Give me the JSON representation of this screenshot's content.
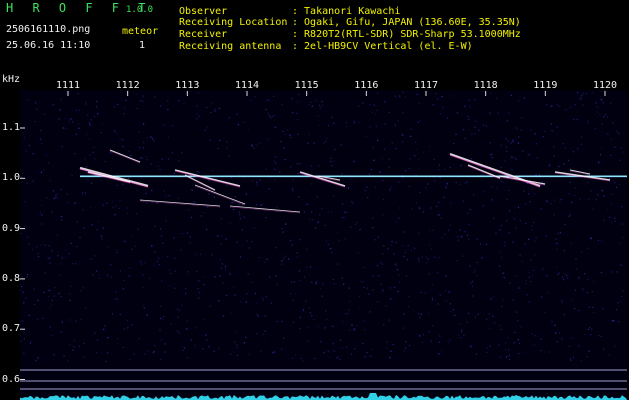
{
  "app": {
    "title": "H R O F F T",
    "version": "1.0.0"
  },
  "file": {
    "name": "2506161110.png",
    "datetime": "25.06.16 11:10"
  },
  "meteor": {
    "label": "meteor",
    "count": "1"
  },
  "info": [
    {
      "label": "Observer",
      "value": ": Takanori Kawachi"
    },
    {
      "label": "Receiving Location",
      "value": ": Ogaki, Gifu, JAPAN (136.60E, 35.35N)"
    },
    {
      "label": "Receiver",
      "value": ": R820T2(RTL-SDR) SDR-Sharp 53.1000MHz"
    },
    {
      "label": "Receiving antenna",
      "value": ": 2el-HB9CV Vertical (el. E-W)"
    }
  ],
  "spectrogram": {
    "yunit": "kHz",
    "xticks": [
      "1111",
      "1112",
      "1113",
      "1114",
      "1115",
      "1116",
      "1117",
      "1118",
      "1119",
      "1120"
    ],
    "yticks": [
      "1.1",
      "1.0",
      "0.9",
      "0.8",
      "0.7",
      "0.6"
    ],
    "ylim": [
      0.6,
      1.1
    ],
    "xlim": [
      "1111",
      "1120"
    ],
    "colors": {
      "background": "#000010",
      "carrier": "#8fe8ff",
      "meteor": "#ffffff",
      "noise": "#2a2aa0",
      "baseline": "#c8c8ff",
      "level": "#30d0e8"
    }
  }
}
